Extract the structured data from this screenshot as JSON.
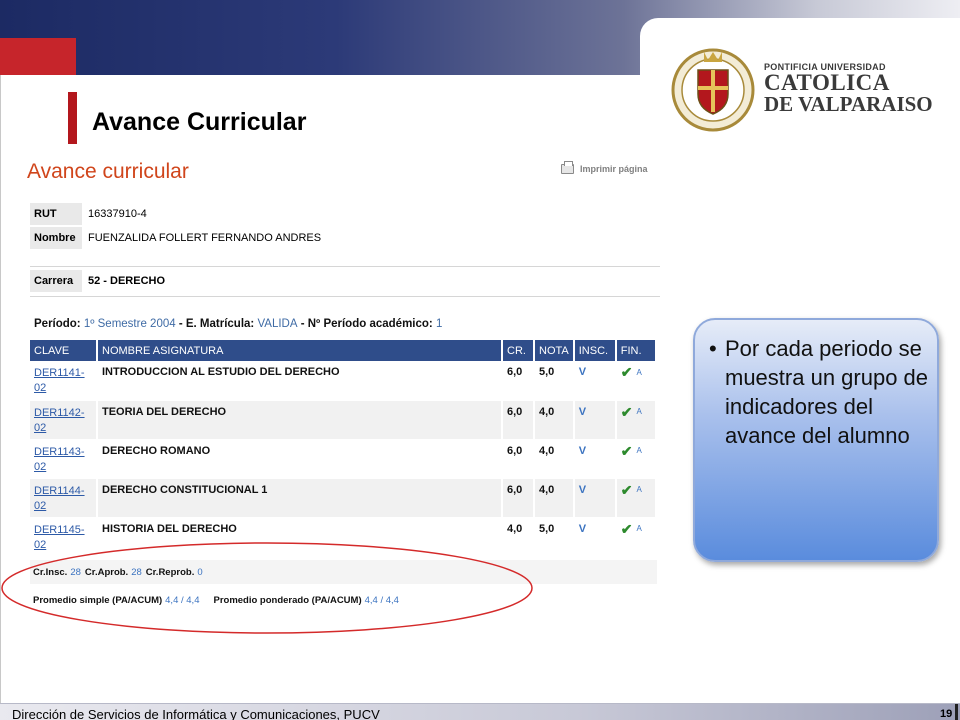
{
  "slide": {
    "title": "Avance Curricular"
  },
  "university": {
    "line1": "PONTIFICIA UNIVERSIDAD",
    "line2": "CATOLICA",
    "line3": "DE VALPARAISO"
  },
  "page": {
    "heading": "Avance curricular",
    "print_label": "Imprimir página",
    "rut_label": "RUT",
    "rut_value": "16337910-4",
    "nombre_label": "Nombre",
    "nombre_value": "FUENZALIDA FOLLERT FERNANDO ANDRES",
    "carrera_label": "Carrera",
    "carrera_value": "52 - DERECHO",
    "periodo": {
      "label": "Período:",
      "value": "1º Semestre 2004",
      "matricula_label": "E. Matrícula:",
      "matricula_value": "VALIDA",
      "num_label": "Nº Período académico:",
      "num_value": "1"
    },
    "table": {
      "headers": [
        "CLAVE",
        "NOMBRE ASIGNATURA",
        "CR.",
        "NOTA",
        "INSC.",
        "FIN."
      ],
      "rows": [
        {
          "code": "DER1141-02",
          "name": "INTRODUCCION AL ESTUDIO DEL DERECHO",
          "cr": "6,0",
          "nota": "5,0",
          "insc": "V",
          "fin": "A"
        },
        {
          "code": "DER1142-02",
          "name": "TEORIA DEL DERECHO",
          "cr": "6,0",
          "nota": "4,0",
          "insc": "V",
          "fin": "A"
        },
        {
          "code": "DER1143-02",
          "name": "DERECHO ROMANO",
          "cr": "6,0",
          "nota": "4,0",
          "insc": "V",
          "fin": "A"
        },
        {
          "code": "DER1144-02",
          "name": "DERECHO CONSTITUCIONAL 1",
          "cr": "6,0",
          "nota": "4,0",
          "insc": "V",
          "fin": "A"
        },
        {
          "code": "DER1145-02",
          "name": "HISTORIA DEL DERECHO",
          "cr": "4,0",
          "nota": "5,0",
          "insc": "V",
          "fin": "A"
        }
      ]
    },
    "credits": {
      "insc_label": "Cr.Insc.",
      "insc_value": "28",
      "aprob_label": "Cr.Aprob.",
      "aprob_value": "28",
      "reprob_label": "Cr.Reprob.",
      "reprob_value": "0"
    },
    "averages": {
      "simple_label": "Promedio simple (PA/ACUM)",
      "simple_value": "4,4 / 4,4",
      "ponderado_label": "Promedio ponderado (PA/ACUM)",
      "ponderado_value": "4,4 / 4,4"
    }
  },
  "callout": {
    "bullet": "•",
    "text": "Por cada periodo se muestra un grupo de indicadores del avance del alumno"
  },
  "footer": {
    "text": "Dirección de Servicios de Informática y Comunicaciones, PUCV",
    "page_number": "19"
  },
  "colors": {
    "accent_red": "#c6252b",
    "header_blue": "#2f4d8a",
    "link_blue": "#2d5aa7",
    "heading_orange": "#d0451b",
    "ellipse_red": "#d42a2a"
  }
}
